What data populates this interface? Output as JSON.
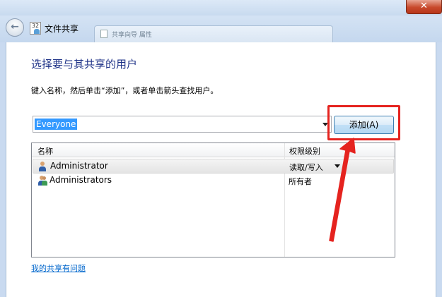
{
  "window": {
    "title": "文件共享",
    "behind_window_text": "共享向导 属性",
    "close_glyph": "✕"
  },
  "nav": {
    "back_glyph": "←",
    "icon_label": "32"
  },
  "main": {
    "heading": "选择要与其共享的用户",
    "instructions": "键入名称，然后单击“添加”，或者单击箭头查找用户。",
    "combo_value": "Everyone",
    "add_button": "添加(A)",
    "help_link": "我的共享有问题"
  },
  "list": {
    "headers": [
      "名称",
      "权限级别"
    ],
    "rows": [
      {
        "name": "Administrator",
        "permission": "读取/写入",
        "icon": "user-icon",
        "selected": true
      },
      {
        "name": "Administrators",
        "permission": "所有者",
        "icon": "group-icon",
        "selected": false
      }
    ]
  },
  "colors": {
    "accent_heading": "#1e3287",
    "highlight_red": "#e5231f",
    "selection_blue": "#3399ff",
    "link_blue": "#0066cc"
  }
}
